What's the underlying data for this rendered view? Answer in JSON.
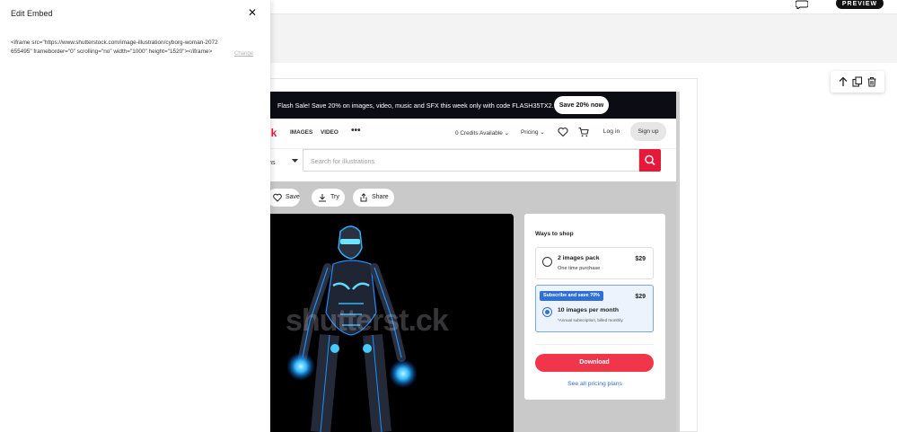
{
  "app": {
    "preview_label": "PREVIEW",
    "icons": [
      "chat-icon",
      "move-up-icon",
      "duplicate-icon",
      "trash-icon",
      "close-icon"
    ]
  },
  "panel": {
    "title": "Edit Embed",
    "code": "<iframe src=\"https://www.shutterstock.com/image-illustration/cyborg-woman-2072655495\" frameborder=\"0\" scrolling=\"no\" width=\"1000\" height=\"1520\"></iframe>",
    "change_label": "Change"
  },
  "embed": {
    "flash": {
      "text": "Flash Sale! Save 20% on images, video, music and SFX this week only with code FLASH35TX2.",
      "button": "Save 20% now"
    },
    "nav": {
      "logo": "ck",
      "links": [
        "IMAGES",
        "VIDEO"
      ],
      "dots": "•••",
      "credits": "0 Credits Available ⌄",
      "pricing": "Pricing ⌄",
      "login": "Log in",
      "signup": "Sign up"
    },
    "search": {
      "category": "ons",
      "placeholder": "Search for illustrations"
    },
    "actions": {
      "save": "Save",
      "try": "Try",
      "share": "Share"
    },
    "image": {
      "watermark": "shutterst.ck"
    },
    "shop": {
      "title": "Ways to shop",
      "option1": {
        "name": "2 images pack",
        "sub": "One time purchase",
        "price": "$29"
      },
      "option2": {
        "badge": "Subscribe and save 70%",
        "name": "10 images per month",
        "sub": "*Annual subscription, billed monthly.",
        "price": "$29"
      },
      "download": "Download",
      "plans_link": "See all pricing plans"
    }
  },
  "colors": {
    "brand_red": "#e51a3a",
    "download_red": "#f1354a",
    "accent_blue": "#2f6fd8",
    "flash_bg": "#0c0c14"
  }
}
